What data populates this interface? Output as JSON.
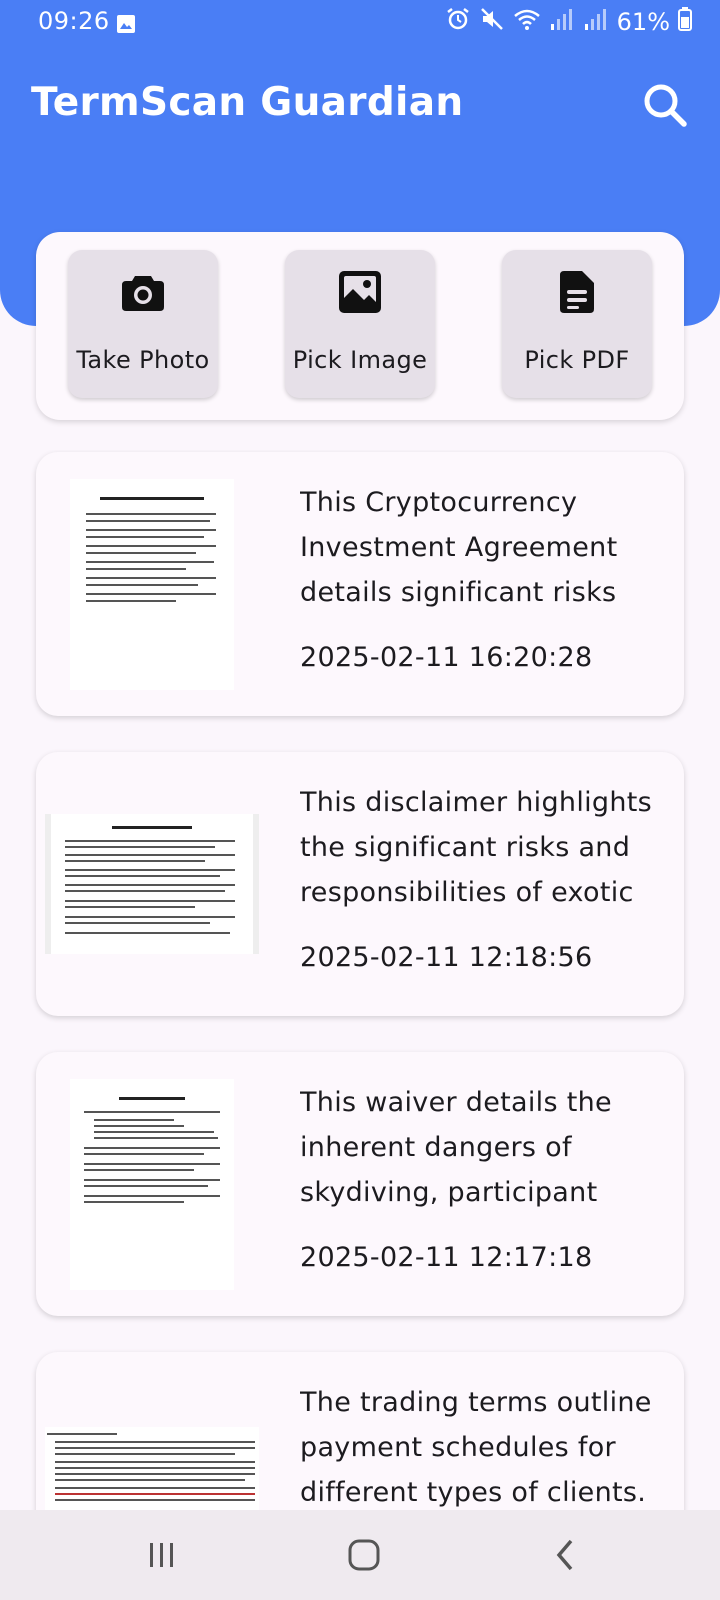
{
  "status_bar": {
    "time": "09:26",
    "battery": "61%"
  },
  "app": {
    "title": "TermScan Guardian",
    "accent_color": "#4a7ef5"
  },
  "actions": [
    {
      "label": "Take Photo",
      "icon": "camera-icon"
    },
    {
      "label": "Pick Image",
      "icon": "image-icon"
    },
    {
      "label": "Pick PDF",
      "icon": "document-icon"
    }
  ],
  "documents": [
    {
      "summary": "This Cryptocurrency Investment Agreement details significant risks",
      "date": "2025-02-11 16:20:28"
    },
    {
      "summary": "This disclaimer highlights the significant risks and responsibilities of exotic",
      "date": "2025-02-11 12:18:56"
    },
    {
      "summary": "This waiver details the inherent dangers of skydiving, participant",
      "date": "2025-02-11 12:17:18"
    },
    {
      "summary": "The trading terms outline payment schedules for different types of clients.",
      "date": ""
    }
  ],
  "nav": {
    "recents_icon": "recents-icon",
    "home_icon": "home-icon",
    "back_icon": "back-icon"
  }
}
